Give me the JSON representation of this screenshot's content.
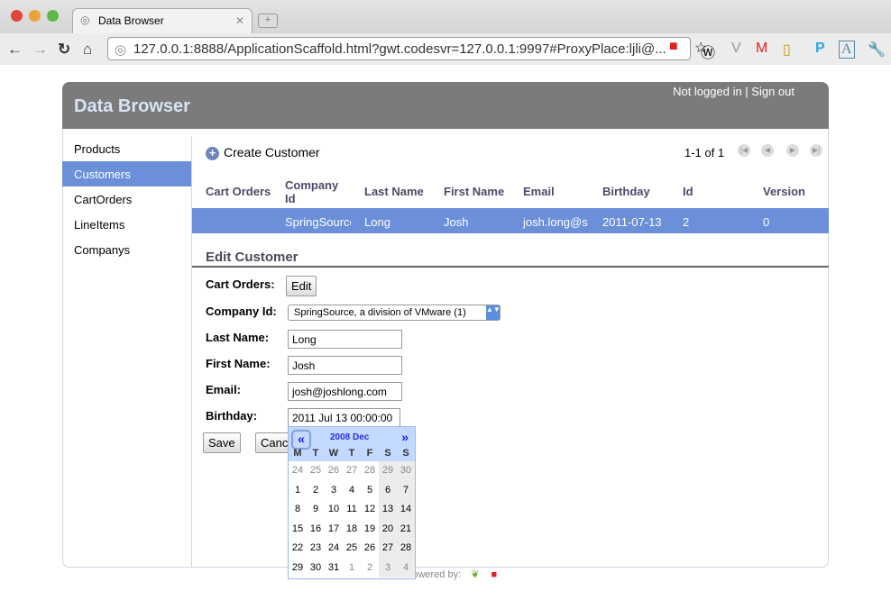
{
  "browser": {
    "tab_title": "Data Browser",
    "url": "127.0.0.1:8888/ApplicationScaffold.html?gwt.codesvr=127.0.0.1:9997#ProxyPlace:ljli@..."
  },
  "header": {
    "title": "Data Browser",
    "login": "Not logged in | Sign out"
  },
  "sidebar": {
    "items": [
      {
        "label": "Products"
      },
      {
        "label": "Customers"
      },
      {
        "label": "CartOrders"
      },
      {
        "label": "LineItems"
      },
      {
        "label": "Companys"
      }
    ]
  },
  "list": {
    "create_label": "Create Customer",
    "pager": "1-1 of 1",
    "columns": [
      "Cart Orders",
      "Company Id",
      "Last Name",
      "First Name",
      "Email",
      "Birthday",
      "Id",
      "Version"
    ],
    "rows": [
      [
        "",
        "SpringSource",
        "Long",
        "Josh",
        "josh.long@s",
        "2011-07-13",
        "2",
        "0"
      ]
    ]
  },
  "edit": {
    "title": "Edit Customer",
    "cart_orders_label": "Cart Orders:",
    "edit_button": "Edit",
    "company_label": "Company Id:",
    "company_value": "SpringSource, a division of VMware (1)",
    "last_name_label": "Last Name:",
    "last_name": "Long",
    "first_name_label": "First Name:",
    "first_name": "Josh",
    "email_label": "Email:",
    "email": "josh@joshlong.com",
    "birthday_label": "Birthday:",
    "birthday": "2011 Jul 13 00:00:00",
    "save": "Save",
    "cancel": "Cancel"
  },
  "calendar": {
    "month": "2008 Dec",
    "prev": "«",
    "next": "»",
    "dow": [
      "M",
      "T",
      "W",
      "T",
      "F",
      "S",
      "S"
    ],
    "weeks": [
      [
        "24",
        "25",
        "26",
        "27",
        "28",
        "29",
        "30"
      ],
      [
        "1",
        "2",
        "3",
        "4",
        "5",
        "6",
        "7"
      ],
      [
        "8",
        "9",
        "10",
        "11",
        "12",
        "13",
        "14"
      ],
      [
        "15",
        "16",
        "17",
        "18",
        "19",
        "20",
        "21"
      ],
      [
        "22",
        "23",
        "24",
        "25",
        "26",
        "27",
        "28"
      ],
      [
        "29",
        "30",
        "31",
        "1",
        "2",
        "3",
        "4"
      ]
    ]
  },
  "footer": {
    "powered": "Powered by:"
  }
}
